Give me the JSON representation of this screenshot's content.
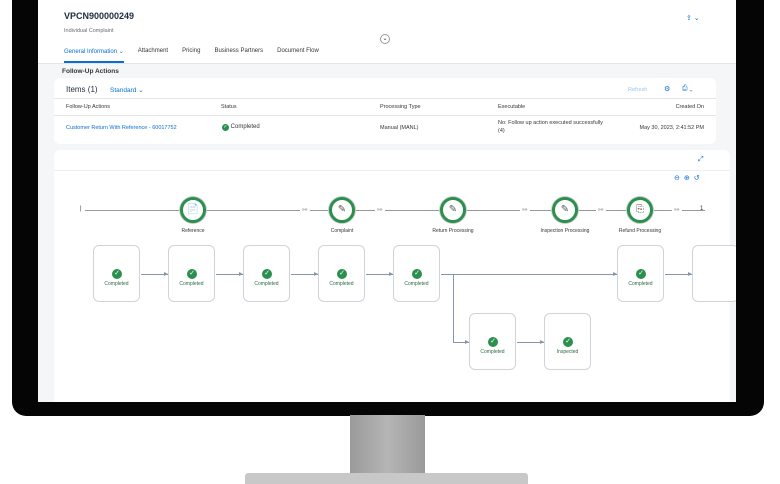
{
  "header": {
    "title": "VPCN900000249",
    "subtitle": "Individual Complaint",
    "collapse_icon": "chevron-down-icon",
    "share_icon": "share-icon"
  },
  "tabs": [
    {
      "label": "General Information",
      "active": true
    },
    {
      "label": "Attachment"
    },
    {
      "label": "Pricing"
    },
    {
      "label": "Business Partners"
    },
    {
      "label": "Document Flow"
    }
  ],
  "section_title": "Follow-Up Actions",
  "items": {
    "title": "Items (1)",
    "variant": "Standard",
    "refresh": "Refresh",
    "columns": [
      "Follow-Up Actions",
      "Status",
      "Processing Type",
      "Executable",
      "Created On"
    ],
    "rows": [
      {
        "action": "Customer Return With Reference - 60017752",
        "status": "Completed",
        "processing_type": "Manual (MANL)",
        "executable": "No: Follow up action executed successfully (4)",
        "created_on": "May 30, 2023, 2:41:52 PM"
      }
    ]
  },
  "flow": {
    "lanes": [
      "Reference",
      "Complaint",
      "Return Processing",
      "Inspection Processing",
      "Refund Processing"
    ],
    "lane_more": "1",
    "nodes": [
      "Completed",
      "Completed",
      "Completed",
      "Completed",
      "Completed",
      "Completed",
      "Completed",
      "Inspected"
    ],
    "colors": {
      "success": "#2b8f4e",
      "link": "#0a6ed1"
    }
  }
}
